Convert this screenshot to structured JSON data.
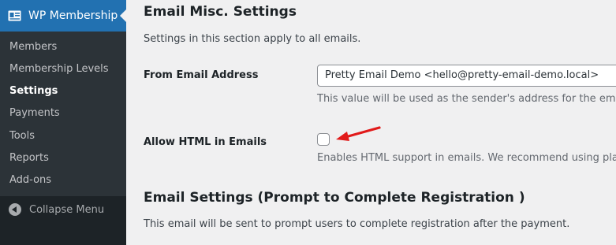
{
  "sidebar": {
    "menu_title": "WP Membership",
    "items": [
      {
        "label": "Members"
      },
      {
        "label": "Membership Levels"
      },
      {
        "label": "Settings"
      },
      {
        "label": "Payments"
      },
      {
        "label": "Tools"
      },
      {
        "label": "Reports"
      },
      {
        "label": "Add-ons"
      }
    ],
    "current_item": "Settings",
    "collapse_label": "Collapse Menu"
  },
  "main": {
    "misc_section": {
      "title": "Email Misc. Settings",
      "description": "Settings in this section apply to all emails.",
      "from_email": {
        "label": "From Email Address",
        "value": "Pretty Email Demo <hello@pretty-email-demo.local>",
        "help": "This value will be used as the sender's address for the emails."
      },
      "allow_html": {
        "label": "Allow HTML in Emails",
        "checked": false,
        "help": "Enables HTML support in emails. We recommend using plain t"
      }
    },
    "prompt_section": {
      "title": "Email Settings (Prompt to Complete Registration )",
      "description": "This email will be sent to prompt users to complete registration after the payment."
    }
  },
  "colors": {
    "sidebar_bg": "#1d2327",
    "submenu_bg": "#2c3338",
    "active_menu_bg": "#2271b1",
    "content_bg": "#f0f0f1",
    "annotation_arrow": "#e11a1a"
  }
}
